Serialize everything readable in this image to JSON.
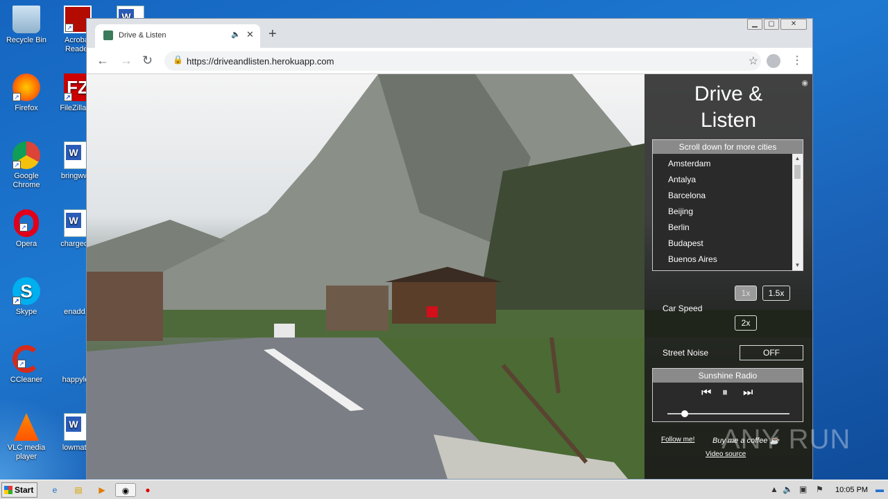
{
  "desktop": {
    "icons": [
      {
        "label": "Recycle Bin"
      },
      {
        "label": "Acrobat Reader"
      },
      {
        "label": "Firefox"
      },
      {
        "label": "FileZilla Cl"
      },
      {
        "label": "Google Chrome"
      },
      {
        "label": "bringwww"
      },
      {
        "label": "Opera"
      },
      {
        "label": "chargecivi"
      },
      {
        "label": "Skype"
      },
      {
        "label": "enadd.p"
      },
      {
        "label": "CCleaner"
      },
      {
        "label": "happylea"
      },
      {
        "label": "VLC media player"
      },
      {
        "label": "lowmatur"
      }
    ]
  },
  "browser": {
    "tab_title": "Drive & Listen",
    "new_tab": "+",
    "url": "https://driveandlisten.herokuapp.com"
  },
  "panel": {
    "title_line1": "Drive &",
    "title_line2": "Listen",
    "city_header": "Scroll down for more cities",
    "cities": [
      "Amsterdam",
      "Antalya",
      "Barcelona",
      "Beijing",
      "Berlin",
      "Budapest",
      "Buenos Aires"
    ],
    "car_speed_label": "Car Speed",
    "speed_options": [
      "1x",
      "1.5x",
      "2x"
    ],
    "selected_speed": "1x",
    "street_noise_label": "Street Noise",
    "street_noise_value": "OFF",
    "radio_name": "Sunshine Radio",
    "volume": 0.14,
    "follow_link": "Follow me!",
    "coffee_text": "Buy me a coffee",
    "video_source_link": "Video source"
  },
  "watermark": "ANY RUN",
  "taskbar": {
    "start_label": "Start",
    "time": "10:05 PM"
  },
  "colors": {
    "desktop_bg": "#1e78d0",
    "panel_bg": "#141414",
    "active_speed_bg": "#9a9a9a"
  }
}
